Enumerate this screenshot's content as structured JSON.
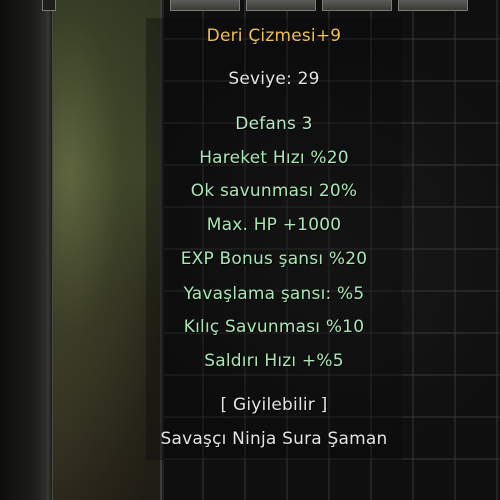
{
  "tooltip": {
    "item_name": "Deri Çizmesi+9",
    "level": "Seviye: 29",
    "defense": "Defans 3",
    "bonuses": [
      "Hareket Hızı %20",
      "Ok savunması 20%",
      "Max. HP +1000",
      "EXP Bonus şansı %20",
      "Yavaşlama şansı: %5",
      "Kılıç Savunması %10",
      "Saldırı Hızı +%5"
    ],
    "wearable": "[ Giyilebilir ]",
    "classes": "Savaşçı Ninja Sura Şaman"
  },
  "colors": {
    "item_name": "#f2c04e",
    "level": "#e4e4e4",
    "defense": "#b5e8c1",
    "bonus": "#a8e6b4",
    "wearable": "#e4e4e4",
    "classes": "#e4e4e4"
  }
}
